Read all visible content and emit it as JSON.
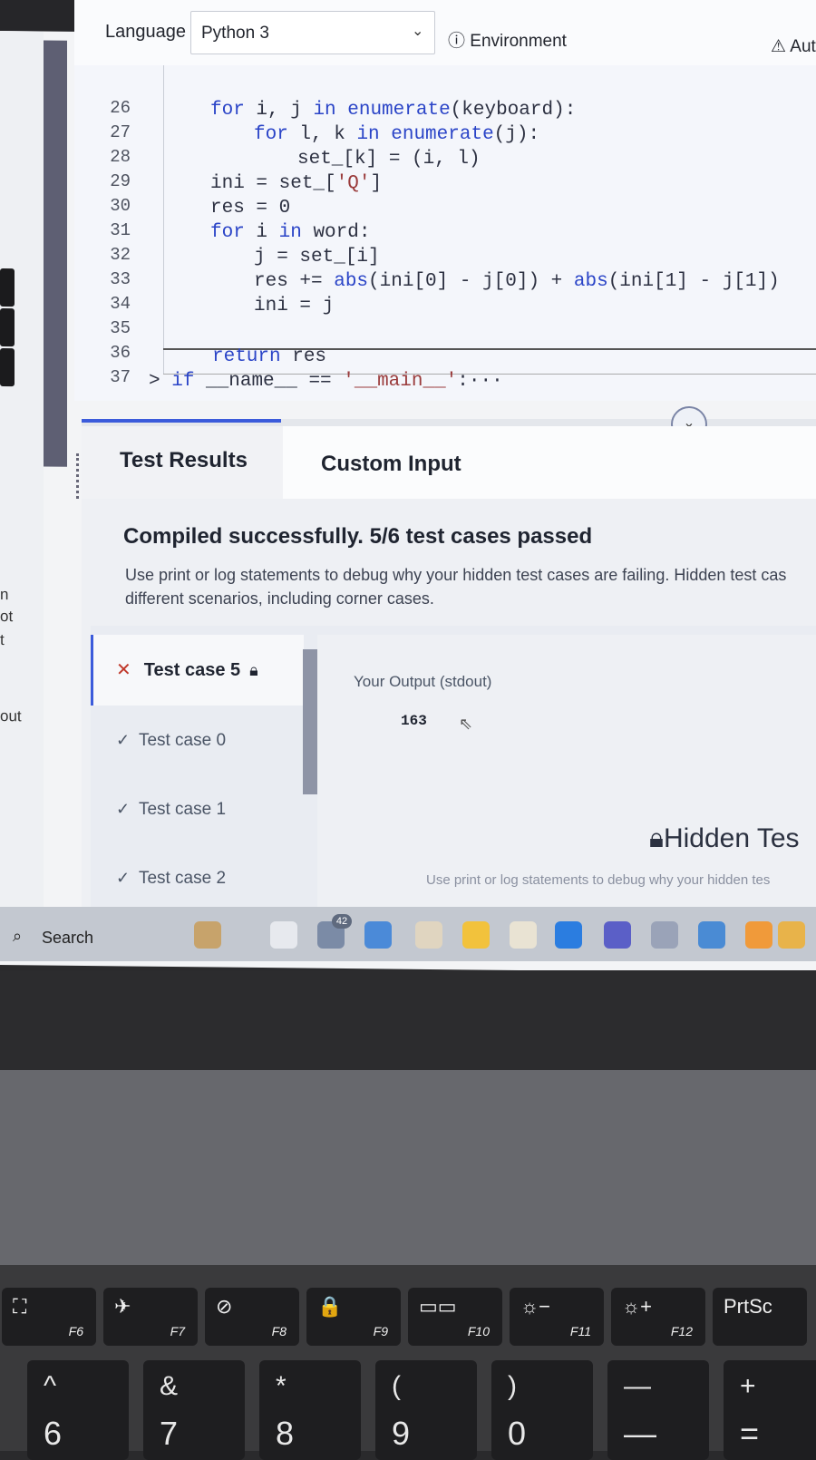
{
  "editor": {
    "language_label": "Language",
    "language_value": "Python 3",
    "environment_label": "Environment",
    "aut_label": "Aut",
    "line_numbers": [
      "26",
      "27",
      "28",
      "29",
      "30",
      "31",
      "32",
      "33",
      "34",
      "35",
      "36",
      "37"
    ],
    "lines": {
      "l26a": "for ",
      "l26b": "i, j ",
      "l26c": "in ",
      "l26d": "enumerate",
      "l26e": "(keyboard):",
      "l27a": "for ",
      "l27b": "l, k ",
      "l27c": "in ",
      "l27d": "enumerate",
      "l27e": "(j):",
      "l28": "set_[k] = (i, l)",
      "l29a": "ini = set_[",
      "l29b": "'Q'",
      "l29c": "]",
      "l30": "res = 0",
      "l31a": "for ",
      "l31b": "i ",
      "l31c": "in ",
      "l31d": "word:",
      "l32": "j = set_[i]",
      "l33a": "res += ",
      "l33b": "abs",
      "l33c": "(ini[0] - j[0]) + ",
      "l33d": "abs",
      "l33e": "(ini[1] - j[1])",
      "l34": "ini = j",
      "l36a": "return ",
      "l36b": "res",
      "l37a": "> ",
      "l37b": "if ",
      "l37c": "__name__ == ",
      "l37d": "'__main__'",
      "l37e": ":···"
    }
  },
  "tabs": {
    "test_results": "Test Results",
    "custom_input": "Custom Input"
  },
  "results": {
    "headline": "Compiled successfully. 5/6 test cases passed",
    "sub1": "Use print or log statements to debug why your hidden test cases are failing. Hidden test cas",
    "sub2": "different scenarios, including corner cases.",
    "active_case": "Test case 5",
    "cases": [
      "Test case 0",
      "Test case 1",
      "Test case 2"
    ],
    "output_label": "Your Output (stdout)",
    "output_value": "163",
    "hidden_title": "Hidden Tes",
    "hidden_desc": "Use print or log statements to debug why your hidden tes"
  },
  "left_fragments": [
    "n",
    "ot",
    "t",
    "out"
  ],
  "taskbar": {
    "search_label": "Search",
    "badge": "42",
    "app_colors": [
      "#c7a36b",
      "#e7e9ee",
      "#7b8ba6",
      "#4b8ad8",
      "#e0d5c0",
      "#f2c23c",
      "#e9e3d3",
      "#2b7de0",
      "#5b5fc7",
      "#9aa3b8",
      "#4a8bd4",
      "#f09a3a",
      "#e8b34a"
    ]
  },
  "keyboard": {
    "fkeys": [
      {
        "sym": "⛶",
        "label": "F6"
      },
      {
        "sym": "✈",
        "label": "F7"
      },
      {
        "sym": "⊘",
        "label": "F8"
      },
      {
        "sym": "🔒",
        "label": "F9"
      },
      {
        "sym": "▭▭",
        "label": "F10"
      },
      {
        "sym": "☼−",
        "label": "F11"
      },
      {
        "sym": "☼+",
        "label": "F12"
      },
      {
        "sym": "PrtSc",
        "label": ""
      }
    ],
    "numkeys": [
      {
        "top": "^",
        "bot": "6"
      },
      {
        "top": "&",
        "bot": "7"
      },
      {
        "top": "*",
        "bot": "8"
      },
      {
        "top": "(",
        "bot": "9"
      },
      {
        "top": ")",
        "bot": "0"
      },
      {
        "top": "—",
        "bot": "—"
      },
      {
        "top": "+",
        "bot": "="
      }
    ]
  }
}
